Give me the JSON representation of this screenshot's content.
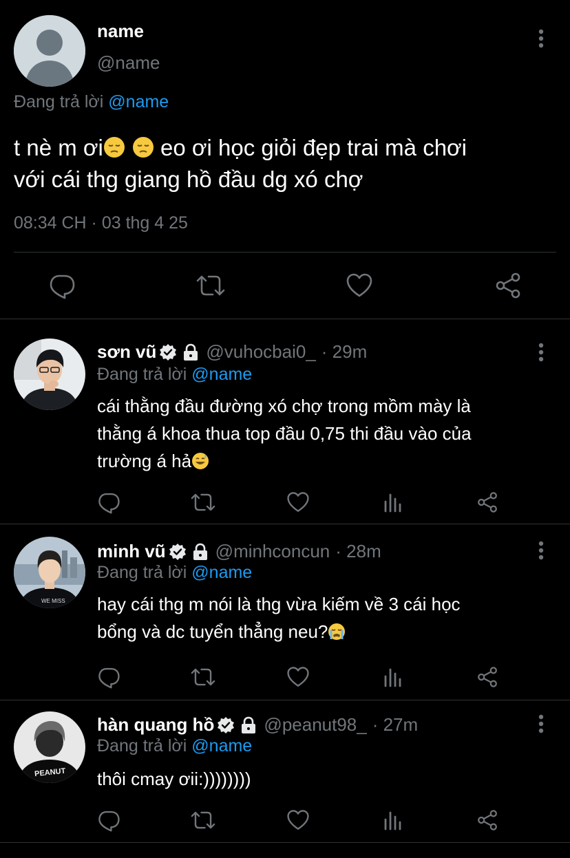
{
  "main_tweet": {
    "name": "name",
    "handle": "@name",
    "replying_prefix": "Đang trả lời",
    "replying_to": "@name",
    "text": "t nè m ơi",
    "text_rest_line1": "eo ơi học giỏi đẹp trai mà chơi",
    "text_line2": "với cái thg giang hồ đầu dg xó chợ",
    "timestamp": "08:34 CH · 03 thg 4 25",
    "actions": [
      "reply-icon",
      "retweet-icon",
      "like-icon",
      "share-icon"
    ]
  },
  "replies": [
    {
      "name": "sơn vũ",
      "handle": "@vuhocbai0_",
      "time": "· 29m",
      "replying_prefix": "Đang trả lời",
      "replying_to": "@name",
      "line1": "cái thằng đầu đường xó chợ trong mồm mày là",
      "line2": "thằng á khoa thua top đầu 0,75 thi đầu vào của",
      "line3": "trường á hả",
      "emoji": "sweat-smile-emoji"
    },
    {
      "name": "minh vũ",
      "handle": "@minhconcun",
      "time": "· 28m",
      "replying_prefix": "Đang trả lời",
      "replying_to": "@name",
      "line1": "hay cái thg m nói là thg vừa kiếm về 3 cái học",
      "line2": "bổng và dc tuyển thẳng neu?",
      "emoji": "crying-emoji"
    },
    {
      "name": "hàn quang hồ",
      "handle": "@peanut98_",
      "time": "· 27m",
      "replying_prefix": "Đang trả lời",
      "replying_to": "@name",
      "line1": "thôi cmay ơii:))))))))",
      "avatar_text": "PEANUT"
    }
  ],
  "reply_actions": [
    "reply-icon",
    "retweet-icon",
    "like-icon",
    "views-icon",
    "share-icon"
  ],
  "colors": {
    "background": "#000000",
    "link": "#1d9bf0",
    "muted": "#71767b",
    "divider": "#2f3336"
  }
}
